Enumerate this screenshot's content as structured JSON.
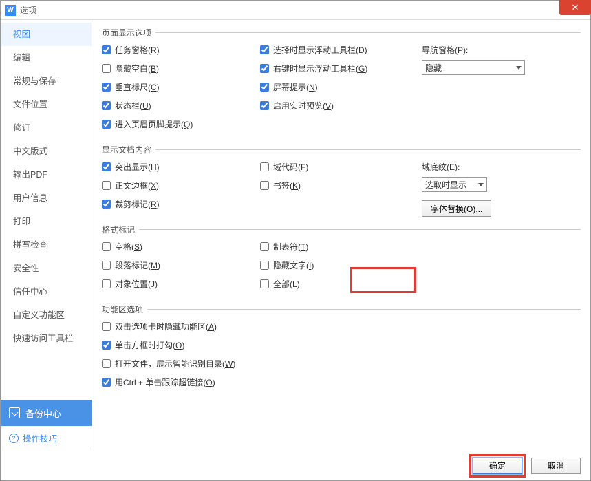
{
  "titlebar": {
    "title": "选项",
    "icon_letter": "W"
  },
  "sidebar": {
    "items": [
      {
        "label": "视图",
        "selected": true
      },
      {
        "label": "编辑"
      },
      {
        "label": "常规与保存"
      },
      {
        "label": "文件位置"
      },
      {
        "label": "修订"
      },
      {
        "label": "中文版式"
      },
      {
        "label": "输出PDF"
      },
      {
        "label": "用户信息"
      },
      {
        "label": "打印"
      },
      {
        "label": "拼写检查"
      },
      {
        "label": "安全性"
      },
      {
        "label": "信任中心"
      },
      {
        "label": "自定义功能区"
      },
      {
        "label": "快速访问工具栏"
      }
    ],
    "backup_label": "备份中心",
    "tips_label": "操作技巧",
    "tips_icon": "?"
  },
  "groups": {
    "page_display": {
      "title": "页面显示选项",
      "colA": [
        {
          "label": "任务窗格(R)",
          "checked": true
        },
        {
          "label": "隐藏空白(B)",
          "checked": false
        },
        {
          "label": "垂直标尺(C)",
          "checked": true
        },
        {
          "label": "状态栏(U)",
          "checked": true
        },
        {
          "label": "进入页眉页脚提示(Q)",
          "checked": true
        }
      ],
      "colB": [
        {
          "label": "选择时显示浮动工具栏(D)",
          "checked": true
        },
        {
          "label": "右键时显示浮动工具栏(G)",
          "checked": true
        },
        {
          "label": "屏幕提示(N)",
          "checked": true
        },
        {
          "label": "启用实时预览(V)",
          "checked": true
        }
      ],
      "nav_label": "导航窗格(P):",
      "nav_value": "隐藏"
    },
    "doc_content": {
      "title": "显示文档内容",
      "colA": [
        {
          "label": "突出显示(H)",
          "checked": true
        },
        {
          "label": "正文边框(X)",
          "checked": false
        },
        {
          "label": "裁剪标记(R)",
          "checked": true
        }
      ],
      "colB": [
        {
          "label": "域代码(F)",
          "checked": false
        },
        {
          "label": "书签(K)",
          "checked": false
        }
      ],
      "shade_label": "域底纹(E):",
      "shade_value": "选取时显示",
      "font_btn": "字体替换(O)..."
    },
    "format_marks": {
      "title": "格式标记",
      "colA": [
        {
          "label": "空格(S)",
          "checked": false
        },
        {
          "label": "段落标记(M)",
          "checked": false
        },
        {
          "label": "对象位置(J)",
          "checked": false
        }
      ],
      "colB": [
        {
          "label": "制表符(T)",
          "checked": false
        },
        {
          "label": "隐藏文字(I)",
          "checked": false
        },
        {
          "label": "全部(L)",
          "checked": false
        }
      ]
    },
    "ribbon": {
      "title": "功能区选项",
      "items": [
        {
          "label": "双击选项卡时隐藏功能区(A)",
          "checked": false
        },
        {
          "label": "单击方框时打勾(O)",
          "checked": true
        },
        {
          "label": "打开文件，展示智能识别目录(W)",
          "checked": false
        },
        {
          "label": "用Ctrl + 单击跟踪超链接(O)",
          "checked": true
        }
      ]
    }
  },
  "footer": {
    "ok": "确定",
    "cancel": "取消"
  }
}
